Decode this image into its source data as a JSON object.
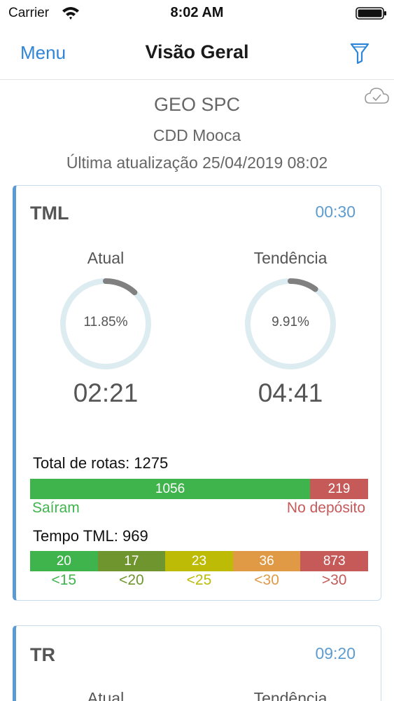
{
  "status": {
    "carrier": "Carrier",
    "time": "8:02 AM"
  },
  "nav": {
    "menu_label": "Menu",
    "title": "Visão Geral"
  },
  "header": {
    "company": "GEO SPC",
    "unit": "CDD Mooca",
    "updated": "Última atualização 25/04/2019 08:02"
  },
  "cards": [
    {
      "title": "TML",
      "time": "00:30",
      "gauges": [
        {
          "label": "Atual",
          "percent_text": "11.85%",
          "percent": 11.85,
          "time": "02:21"
        },
        {
          "label": "Tendência",
          "percent_text": "9.91%",
          "percent": 9.91,
          "time": "04:41"
        }
      ],
      "routes": {
        "label": "Total de rotas: 1275",
        "left_value": "1056",
        "right_value": "219",
        "left_caption": "Saíram",
        "right_caption": "No depósito"
      },
      "tempo": {
        "label": "Tempo TML: 969",
        "buckets": [
          {
            "value": "20",
            "label": "<15"
          },
          {
            "value": "17",
            "label": "<20"
          },
          {
            "value": "23",
            "label": "<25"
          },
          {
            "value": "36",
            "label": "<30"
          },
          {
            "value": "873",
            "label": ">30"
          }
        ]
      }
    },
    {
      "title": "TR",
      "time": "09:20",
      "gauges": [
        {
          "label": "Atual"
        },
        {
          "label": "Tendência"
        }
      ]
    }
  ],
  "colors": {
    "accent": "#2f86d6",
    "green": "#40b44c",
    "red": "#c55a59",
    "bucket_colors": [
      "#40b44c",
      "#6f962e",
      "#bdbb06",
      "#e09a45",
      "#c55a59"
    ],
    "bucket_label_colors": [
      "#40b44c",
      "#6f962e",
      "#bdbb06",
      "#e09a45",
      "#c55a59"
    ]
  },
  "icons": {
    "wifi": "wifi-icon",
    "battery": "battery-icon",
    "filter": "filter-icon",
    "cloud": "cloud-check-icon"
  }
}
